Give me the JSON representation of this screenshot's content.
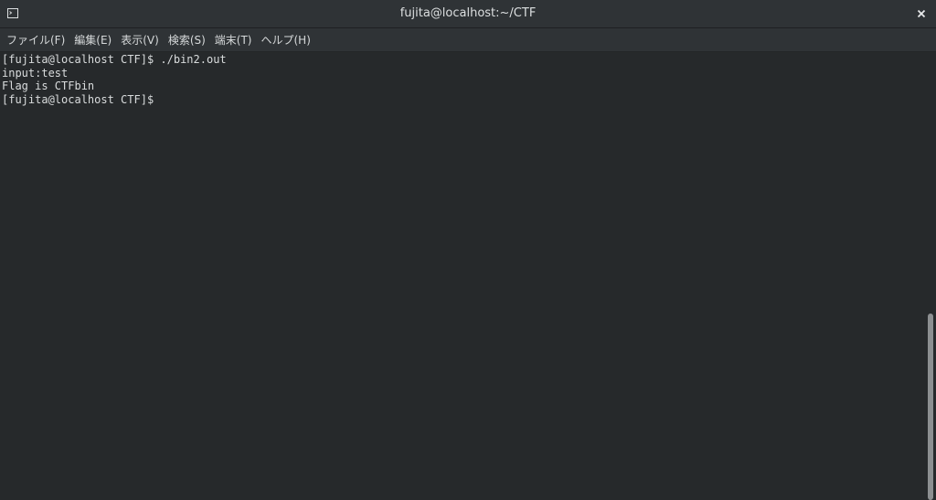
{
  "window": {
    "title": "fujita@localhost:~/CTF"
  },
  "menu": [
    {
      "id": "file",
      "label": "ファイル(F)"
    },
    {
      "id": "edit",
      "label": "編集(E)"
    },
    {
      "id": "view",
      "label": "表示(V)"
    },
    {
      "id": "search",
      "label": "検索(S)"
    },
    {
      "id": "terminal",
      "label": "端末(T)"
    },
    {
      "id": "help",
      "label": "ヘルプ(H)"
    }
  ],
  "terminal": {
    "lines": [
      "[fujita@localhost CTF]$ ./bin2.out",
      "input:test",
      "Flag is CTFbin",
      "[fujita@localhost CTF]$ "
    ]
  },
  "icons": {
    "window_icon": "terminal-icon",
    "close": "close-icon"
  },
  "colors": {
    "background": "#26292b",
    "titlebar": "#2f3336",
    "text": "#d9dcdd"
  }
}
